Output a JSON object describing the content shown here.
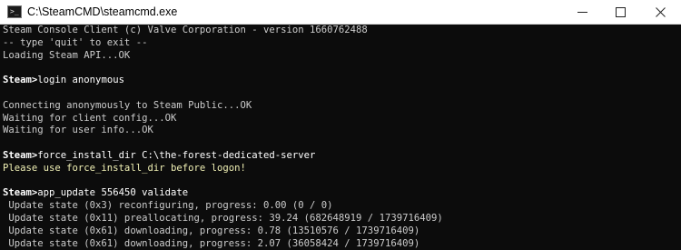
{
  "window": {
    "title": "C:\\SteamCMD\\steamcmd.exe"
  },
  "colors": {
    "console_bg": "#0c0c0c",
    "console_text": "#cccccc",
    "prompt_text": "#ffffff",
    "warning_text": "#f0f0b4"
  },
  "icons": {
    "app": "console-app-icon",
    "minimize": "minimize-icon",
    "maximize": "maximize-icon",
    "close": "close-icon"
  },
  "console": {
    "lines": [
      {
        "type": "text",
        "text": "Steam Console Client (c) Valve Corporation - version 1660762488"
      },
      {
        "type": "text",
        "text": "-- type 'quit' to exit --"
      },
      {
        "type": "text",
        "text": "Loading Steam API...OK"
      },
      {
        "type": "blank",
        "text": ""
      },
      {
        "type": "prompt",
        "prompt": "Steam>",
        "text": "login anonymous"
      },
      {
        "type": "blank",
        "text": ""
      },
      {
        "type": "text",
        "text": "Connecting anonymously to Steam Public...OK"
      },
      {
        "type": "text",
        "text": "Waiting for client config...OK"
      },
      {
        "type": "text",
        "text": "Waiting for user info...OK"
      },
      {
        "type": "blank",
        "text": ""
      },
      {
        "type": "prompt",
        "prompt": "Steam>",
        "text": "force_install_dir C:\\the-forest-dedicated-server"
      },
      {
        "type": "warn",
        "text": "Please use force_install_dir before logon!"
      },
      {
        "type": "blank",
        "text": ""
      },
      {
        "type": "prompt",
        "prompt": "Steam>",
        "text": "app_update 556450 validate"
      },
      {
        "type": "text",
        "text": " Update state (0x3) reconfiguring, progress: 0.00 (0 / 0)"
      },
      {
        "type": "text",
        "text": " Update state (0x11) preallocating, progress: 39.24 (682648919 / 1739716409)"
      },
      {
        "type": "text",
        "text": " Update state (0x61) downloading, progress: 0.78 (13510576 / 1739716409)"
      },
      {
        "type": "text",
        "text": " Update state (0x61) downloading, progress: 2.07 (36058424 / 1739716409)"
      }
    ]
  }
}
